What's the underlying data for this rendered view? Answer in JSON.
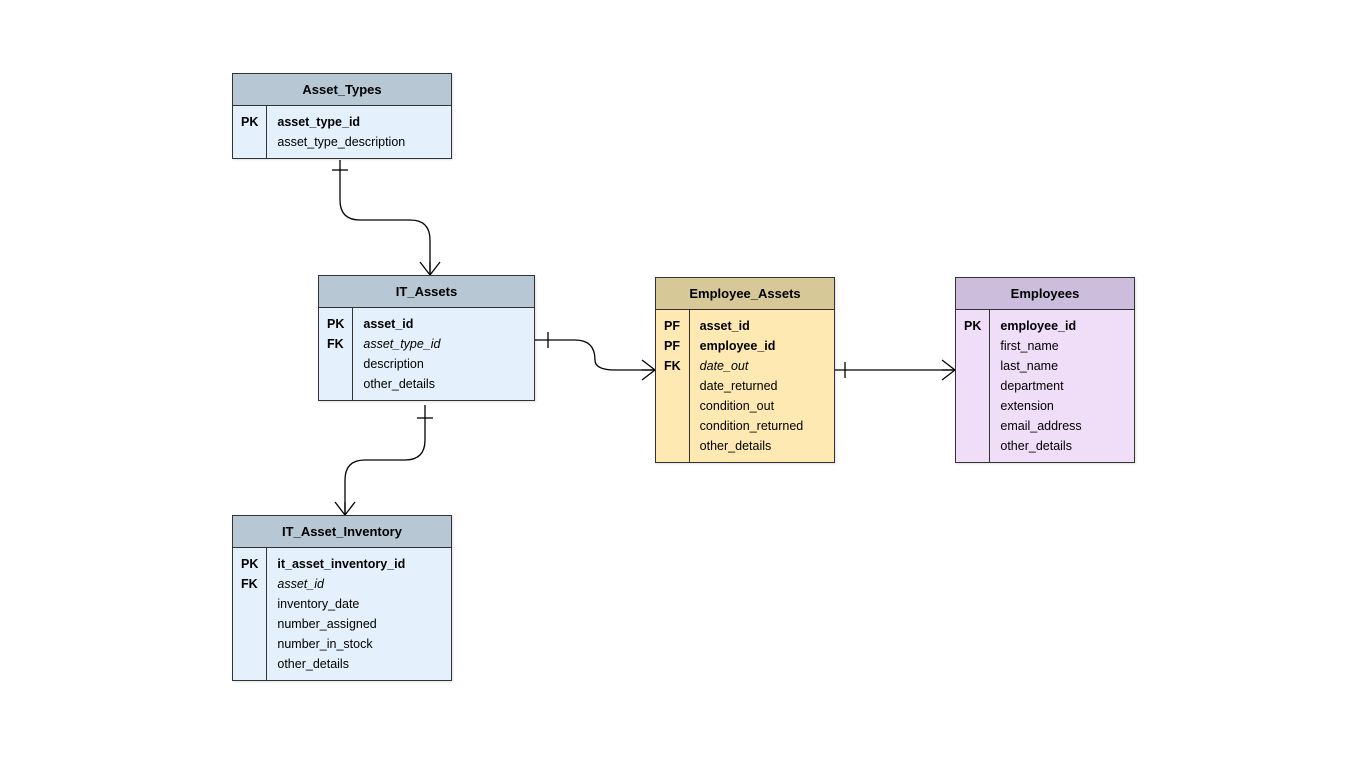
{
  "entities": {
    "asset_types": {
      "title": "Asset_Types",
      "keys": [
        "PK",
        ""
      ],
      "fields": [
        {
          "text": "asset_type_id",
          "style": "bold"
        },
        {
          "text": "asset_type_description",
          "style": ""
        }
      ]
    },
    "it_assets": {
      "title": "IT_Assets",
      "keys": [
        "PK",
        "FK",
        "",
        ""
      ],
      "fields": [
        {
          "text": "asset_id",
          "style": "bold"
        },
        {
          "text": "asset_type_id",
          "style": "italic"
        },
        {
          "text": "description",
          "style": ""
        },
        {
          "text": "other_details",
          "style": ""
        }
      ]
    },
    "employee_assets": {
      "title": "Employee_Assets",
      "keys": [
        "PF",
        "PF",
        "FK",
        "",
        "",
        "",
        ""
      ],
      "fields": [
        {
          "text": "asset_id",
          "style": "bold"
        },
        {
          "text": "employee_id",
          "style": "bold"
        },
        {
          "text": "date_out",
          "style": "italic"
        },
        {
          "text": "date_returned",
          "style": ""
        },
        {
          "text": "condition_out",
          "style": ""
        },
        {
          "text": "condition_returned",
          "style": ""
        },
        {
          "text": "other_details",
          "style": ""
        }
      ]
    },
    "employees": {
      "title": "Employees",
      "keys": [
        "PK",
        "",
        "",
        "",
        "",
        "",
        ""
      ],
      "fields": [
        {
          "text": "employee_id",
          "style": "bold"
        },
        {
          "text": "first_name",
          "style": ""
        },
        {
          "text": "last_name",
          "style": ""
        },
        {
          "text": "department",
          "style": ""
        },
        {
          "text": "extension",
          "style": ""
        },
        {
          "text": "email_address",
          "style": ""
        },
        {
          "text": "other_details",
          "style": ""
        }
      ]
    },
    "it_asset_inventory": {
      "title": "IT_Asset_Inventory",
      "keys": [
        "PK",
        "FK",
        "",
        "",
        "",
        ""
      ],
      "fields": [
        {
          "text": "it_asset_inventory_id",
          "style": "bold"
        },
        {
          "text": "asset_id",
          "style": "italic"
        },
        {
          "text": "inventory_date",
          "style": ""
        },
        {
          "text": "number_assigned",
          "style": ""
        },
        {
          "text": "number_in_stock",
          "style": ""
        },
        {
          "text": "other_details",
          "style": ""
        }
      ]
    }
  }
}
